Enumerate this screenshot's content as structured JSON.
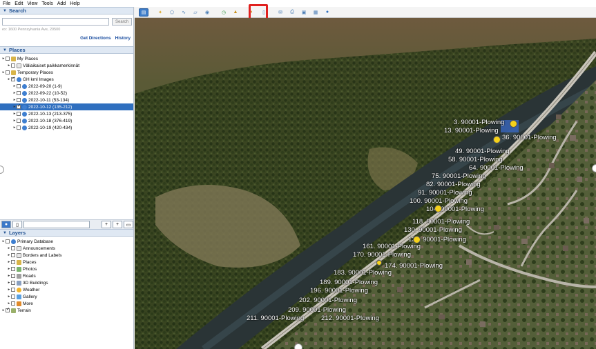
{
  "menu": [
    "File",
    "Edit",
    "View",
    "Tools",
    "Add",
    "Help"
  ],
  "search": {
    "header": "Search",
    "placeholder": "",
    "button": "Search",
    "hint": "ex: 1600 Pennsylvania Ave, 20500",
    "links": [
      "Get Directions",
      "History"
    ]
  },
  "places": {
    "header": "Places",
    "items": [
      {
        "label": "My Places",
        "icon": "folder-icon",
        "level": 0,
        "checked": false
      },
      {
        "label": "Väliaikaiset paikkamerkinnät",
        "icon": "doc-icon",
        "level": 1,
        "checked": false
      },
      {
        "label": "Temporary Places",
        "icon": "folder-icon",
        "level": 0,
        "checked": false
      },
      {
        "label": "GH kml Images",
        "icon": "globe-icon",
        "level": 1,
        "checked": true
      },
      {
        "label": "2022-09-20 (1-9)",
        "icon": "globe-icon",
        "level": 2,
        "checked": false
      },
      {
        "label": "2022-09-22 (10-52)",
        "icon": "globe-icon",
        "level": 2,
        "checked": false
      },
      {
        "label": "2022-10-11 (53-134)",
        "icon": "globe-icon",
        "level": 2,
        "checked": false
      },
      {
        "label": "2022-10-12 (135-212)",
        "icon": "globe-icon",
        "level": 2,
        "checked": true,
        "selected": true
      },
      {
        "label": "2022-10-13 (213-375)",
        "icon": "globe-icon",
        "level": 2,
        "checked": false
      },
      {
        "label": "2022-10-18 (376-419)",
        "icon": "globe-icon",
        "level": 2,
        "checked": false
      },
      {
        "label": "2022-10-19 (420-434)",
        "icon": "globe-icon",
        "level": 2,
        "checked": false
      }
    ]
  },
  "layers": {
    "header": "Layers",
    "items": [
      {
        "label": "Primary Database",
        "icon": "globe-icon",
        "level": 0,
        "checked": false
      },
      {
        "label": "Announcements",
        "icon": "doc-icon",
        "level": 1,
        "checked": false
      },
      {
        "label": "Borders and Labels",
        "icon": "doc-icon",
        "level": 1,
        "checked": false
      },
      {
        "label": "Places",
        "icon": "folder-icon",
        "level": 1,
        "checked": false
      },
      {
        "label": "Photos",
        "icon": "photo-icon",
        "level": 1,
        "checked": false
      },
      {
        "label": "Roads",
        "icon": "road-icon",
        "level": 1,
        "checked": false
      },
      {
        "label": "3D Buildings",
        "icon": "building-icon",
        "level": 1,
        "checked": false
      },
      {
        "label": "Weather",
        "icon": "sun-icon",
        "level": 1,
        "checked": false
      },
      {
        "label": "Gallery",
        "icon": "star-icon",
        "level": 1,
        "checked": false
      },
      {
        "label": "More",
        "icon": "more-icon",
        "level": 1,
        "checked": false
      },
      {
        "label": "Terrain",
        "icon": "terrain-icon",
        "level": 0,
        "checked": true
      }
    ]
  },
  "toolbar": {
    "buttons": [
      "sidebar-toggle",
      "placemark",
      "polygon",
      "path",
      "image-overlay",
      "record-tour",
      "historical-imagery",
      "sun",
      "planets",
      "ruler",
      "email",
      "print",
      "save-image",
      "view-in-maps",
      "sign-in"
    ],
    "highlighted": "ruler"
  },
  "map": {
    "labels": [
      "3. 90001-Plowing",
      "13. 90001-Plowing",
      "36. 90001-Plowing",
      "49. 90001-Plowing",
      "58. 90001-Plowing",
      "64. 90001-Plowing",
      "75. 90001-Plowing",
      "82. 90001-Plowing",
      "91. 90001-Plowing",
      "100. 90001-Plowing",
      "104. 90001-Plowing",
      "118. 90001-Plowing",
      "130. 90001-Plowing",
      "133. 90001-Plowing",
      "161. 90001-Plowing",
      "170. 90001-Plowing",
      "174. 90001-Plowing",
      "183. 90001-Plowing",
      "189. 90001-Plowing",
      "196. 90001-Plowing",
      "202. 90001-Plowing",
      "209. 90001-Plowing",
      "211. 90001-Plowing",
      "212. 90001-Plowing"
    ]
  },
  "colors": {
    "selection": "#2f6fbf",
    "panel_header": "#dfe8f3",
    "highlight": "#e0201e",
    "marker": "#f5d21a"
  }
}
